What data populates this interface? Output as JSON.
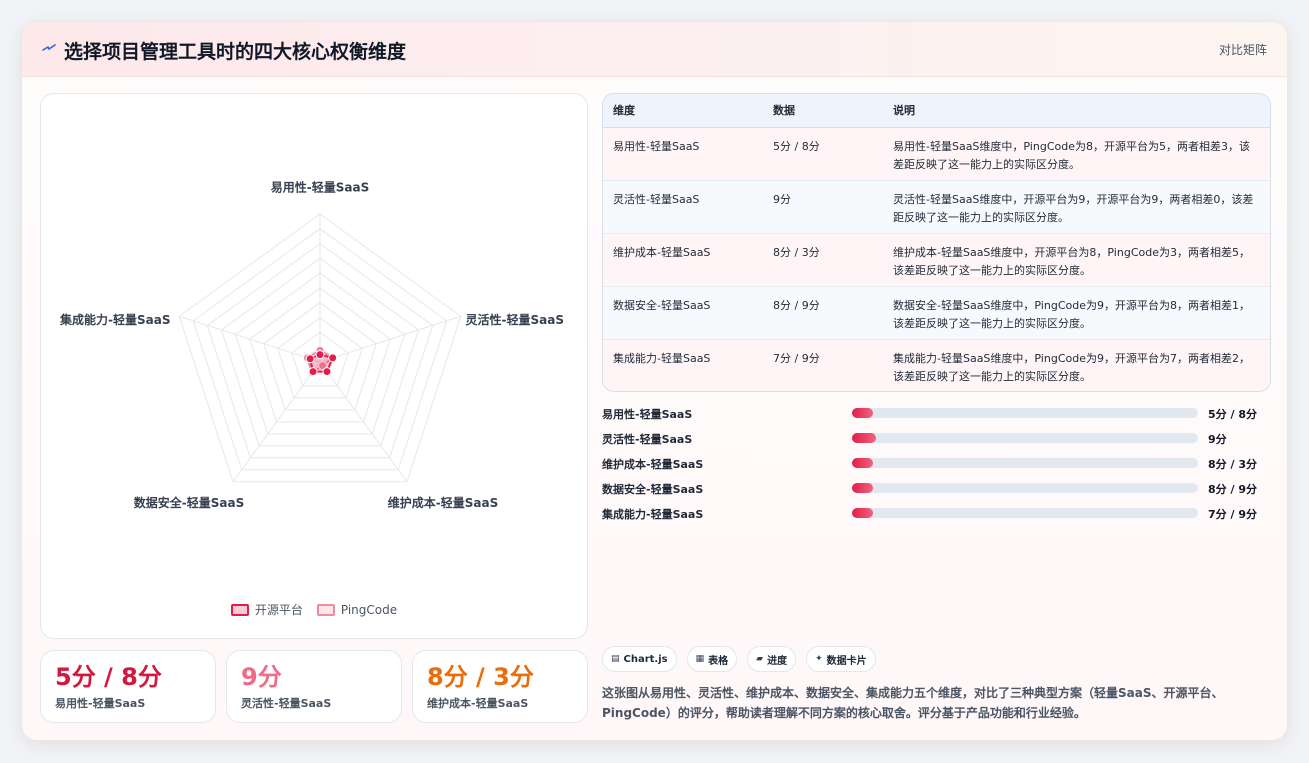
{
  "header": {
    "title": "选择项目管理工具时的四大核心权衡维度",
    "tag": "对比矩阵"
  },
  "colors": {
    "accent": "#e11d48",
    "secondary": "#f08aa0",
    "orange": "#ea6c0a"
  },
  "chart_data": {
    "type": "radar",
    "axes": [
      "易用性-轻量SaaS",
      "灵活性-轻量SaaS",
      "维护成本-轻量SaaS",
      "数据安全-轻量SaaS",
      "集成能力-轻量SaaS"
    ],
    "series": [
      {
        "name": "开源平台",
        "values": [
          5,
          9,
          8,
          8,
          7
        ]
      },
      {
        "name": "PingCode",
        "values": [
          8,
          9,
          3,
          9,
          9
        ]
      }
    ],
    "rlim": [
      0,
      100
    ],
    "grid": true,
    "legend": "bottom"
  },
  "stats": [
    {
      "value": "5分 / 8分",
      "label": "易用性-轻量SaaS",
      "color": "#d4173f"
    },
    {
      "value": "9分",
      "label": "灵活性-轻量SaaS",
      "color": "#f06a85"
    },
    {
      "value": "8分 / 3分",
      "label": "维护成本-轻量SaaS",
      "color": "#ea6c0a"
    }
  ],
  "table": {
    "headers": [
      "维度",
      "数据",
      "说明"
    ],
    "rows": [
      {
        "dim": "易用性-轻量SaaS",
        "data": "5分 / 8分",
        "desc": "易用性-轻量SaaS维度中，PingCode为8，开源平台为5，两者相差3，该差距反映了这一能力上的实际区分度。"
      },
      {
        "dim": "灵活性-轻量SaaS",
        "data": "9分",
        "desc": "灵活性-轻量SaaS维度中，开源平台为9，开源平台为9，两者相差0，该差距反映了这一能力上的实际区分度。"
      },
      {
        "dim": "维护成本-轻量SaaS",
        "data": "8分 / 3分",
        "desc": "维护成本-轻量SaaS维度中，开源平台为8，PingCode为3，两者相差5，该差距反映了这一能力上的实际区分度。"
      },
      {
        "dim": "数据安全-轻量SaaS",
        "data": "8分 / 9分",
        "desc": "数据安全-轻量SaaS维度中，PingCode为9，开源平台为8，两者相差1，该差距反映了这一能力上的实际区分度。"
      },
      {
        "dim": "集成能力-轻量SaaS",
        "data": "7分 / 9分",
        "desc": "集成能力-轻量SaaS维度中，PingCode为9，开源平台为7，两者相差2，该差距反映了这一能力上的实际区分度。"
      }
    ]
  },
  "progress": [
    {
      "label": "易用性-轻量SaaS",
      "value": "5分 / 8分",
      "fill_pct": 6
    },
    {
      "label": "灵活性-轻量SaaS",
      "value": "9分",
      "fill_pct": 7
    },
    {
      "label": "维护成本-轻量SaaS",
      "value": "8分 / 3分",
      "fill_pct": 6
    },
    {
      "label": "数据安全-轻量SaaS",
      "value": "8分 / 9分",
      "fill_pct": 6
    },
    {
      "label": "集成能力-轻量SaaS",
      "value": "7分 / 9分",
      "fill_pct": 6
    }
  ],
  "chips": [
    {
      "icon": "chart-icon",
      "glyph": "▤",
      "label": "Chart.js"
    },
    {
      "icon": "table-icon",
      "glyph": "▦",
      "label": "表格"
    },
    {
      "icon": "progress-icon",
      "glyph": "▰",
      "label": "进度"
    },
    {
      "icon": "card-icon",
      "glyph": "✦",
      "label": "数据卡片"
    }
  ],
  "description": "这张图从易用性、灵活性、维护成本、数据安全、集成能力五个维度，对比了三种典型方案（轻量SaaS、开源平台、PingCode）的评分，帮助读者理解不同方案的核心取舍。评分基于产品功能和行业经验。"
}
